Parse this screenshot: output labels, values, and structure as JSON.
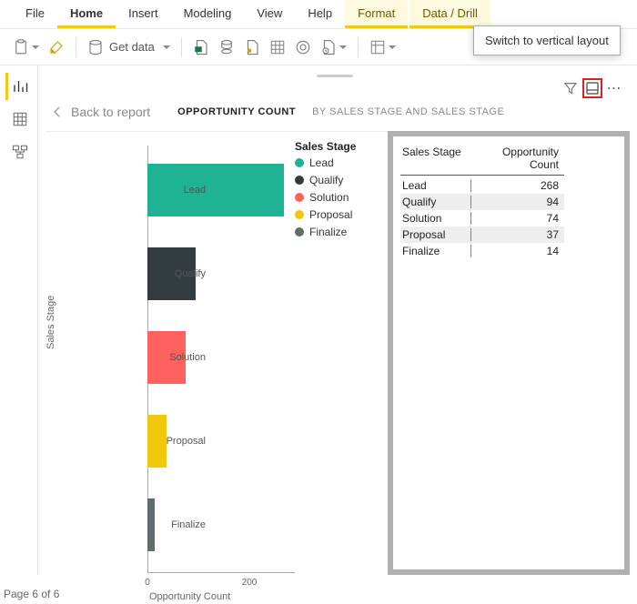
{
  "ribbon": {
    "tabs": [
      "File",
      "Home",
      "Insert",
      "Modeling",
      "View",
      "Help",
      "Format",
      "Data / Drill"
    ],
    "active_tab": "Home",
    "context_tabs": [
      "Format",
      "Data / Drill"
    ],
    "get_data_label": "Get data"
  },
  "tooltip": {
    "text": "Switch to vertical layout"
  },
  "back_label": "Back to report",
  "title_main": "OPPORTUNITY COUNT",
  "title_sub": "BY SALES STAGE AND SALES STAGE",
  "legend_title": "Sales Stage",
  "legend": [
    {
      "label": "Lead",
      "color": "#1db394"
    },
    {
      "label": "Qualify",
      "color": "#333d41"
    },
    {
      "label": "Solution",
      "color": "#fd625e"
    },
    {
      "label": "Proposal",
      "color": "#f2c80f"
    },
    {
      "label": "Finalize",
      "color": "#5f6b6d"
    }
  ],
  "chart_data": {
    "type": "bar",
    "orientation": "horizontal",
    "title": "",
    "xlabel": "Opportunity Count",
    "ylabel": "Sales Stage",
    "categories": [
      "Lead",
      "Qualify",
      "Solution",
      "Proposal",
      "Finalize"
    ],
    "values": [
      268,
      94,
      74,
      37,
      14
    ],
    "colors": [
      "#1db394",
      "#333d41",
      "#fd625e",
      "#f2c80f",
      "#5f6b6d"
    ],
    "x_ticks": [
      0,
      200
    ],
    "xlim": [
      0,
      300
    ]
  },
  "table": {
    "columns": [
      "Sales Stage",
      "Opportunity Count"
    ],
    "rows": [
      {
        "stage": "Lead",
        "count": 268
      },
      {
        "stage": "Qualify",
        "count": 94
      },
      {
        "stage": "Solution",
        "count": 74
      },
      {
        "stage": "Proposal",
        "count": 37
      },
      {
        "stage": "Finalize",
        "count": 14
      }
    ]
  },
  "status": {
    "page_label": "Page 6 of 6"
  }
}
